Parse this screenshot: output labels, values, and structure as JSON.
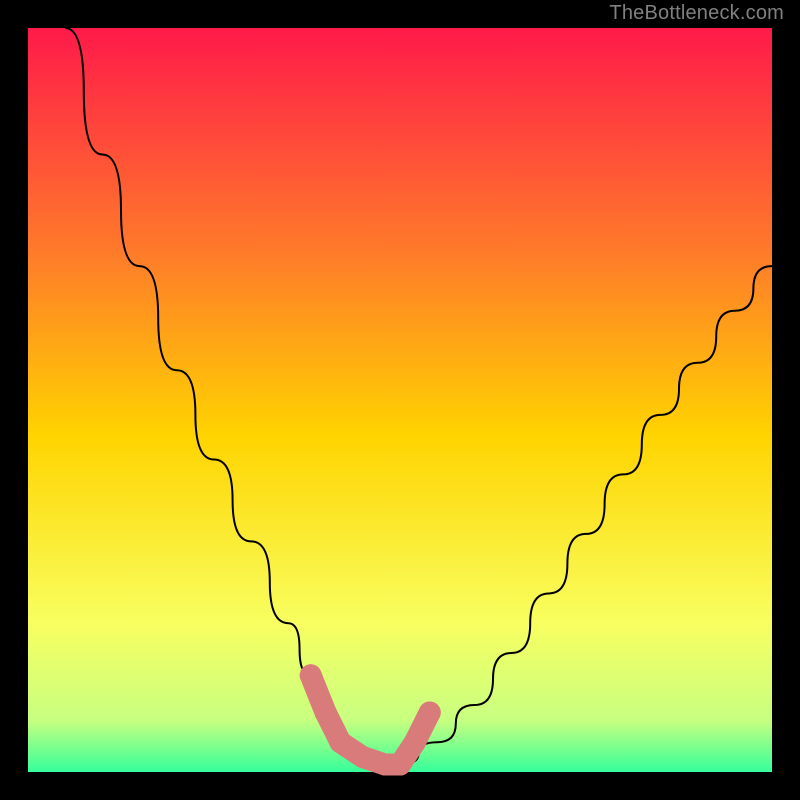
{
  "watermark": "TheBottleneck.com",
  "colors": {
    "bg": "#000000",
    "gradient_top": "#ff1a4a",
    "gradient_mid1": "#ff7a2a",
    "gradient_mid2": "#ffd400",
    "gradient_low1": "#f8ff60",
    "gradient_low2": "#c8ff80",
    "gradient_bottom": "#35ff9a",
    "curve": "#000000",
    "marker": "#d97b7b"
  },
  "chart_data": {
    "type": "line",
    "title": "",
    "xlabel": "",
    "ylabel": "",
    "xlim": [
      0,
      100
    ],
    "ylim": [
      0,
      100
    ],
    "grid": false,
    "legend": false,
    "series": [
      {
        "name": "bottleneck-curve",
        "x": [
          5,
          10,
          15,
          20,
          25,
          30,
          35,
          38,
          40,
          42,
          45,
          48,
          50,
          55,
          60,
          65,
          70,
          75,
          80,
          85,
          90,
          95,
          100
        ],
        "y": [
          100,
          83,
          68,
          54,
          42,
          31,
          20,
          13,
          8,
          4,
          2,
          1,
          1,
          4,
          9,
          16,
          24,
          32,
          40,
          48,
          55,
          62,
          68
        ]
      }
    ],
    "markers": {
      "name": "highlight-points",
      "x": [
        38,
        40,
        42,
        45,
        48,
        50,
        52,
        54
      ],
      "y": [
        13,
        8,
        4,
        2,
        1,
        1,
        4,
        8
      ]
    }
  }
}
